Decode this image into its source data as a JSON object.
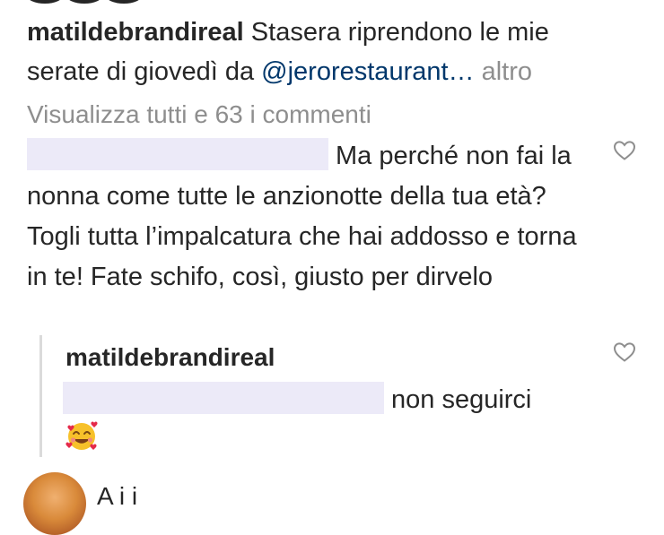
{
  "caption": {
    "username": "matildebrandireal",
    "text": " Stasera riprendono le mie serate di giovedì  da ",
    "mention": "@jerorestaurant…",
    "more": " altro"
  },
  "view_all_comments": "Visualizza tutti e 63 i commenti",
  "comment": {
    "text": "Ma perché non fai la nonna come tutte le anzionotte della tua età? Togli tutta l’impalcatura che hai addosso e torna in te! Fate schifo, così, giusto per dirvelo",
    "like_icon": "heart-outline-icon"
  },
  "reply": {
    "username": "matildebrandireal",
    "text": "non seguirci",
    "emoji": "smiling-face-with-hearts-icon",
    "like_icon": "heart-outline-icon"
  },
  "bottom_comment": {
    "partial_text": "A    i         i"
  },
  "colors": {
    "text": "#262626",
    "muted": "#8e8e8e",
    "mention": "#00376b",
    "redaction": "#eceaf8",
    "thread_line": "#dbdbdb"
  }
}
